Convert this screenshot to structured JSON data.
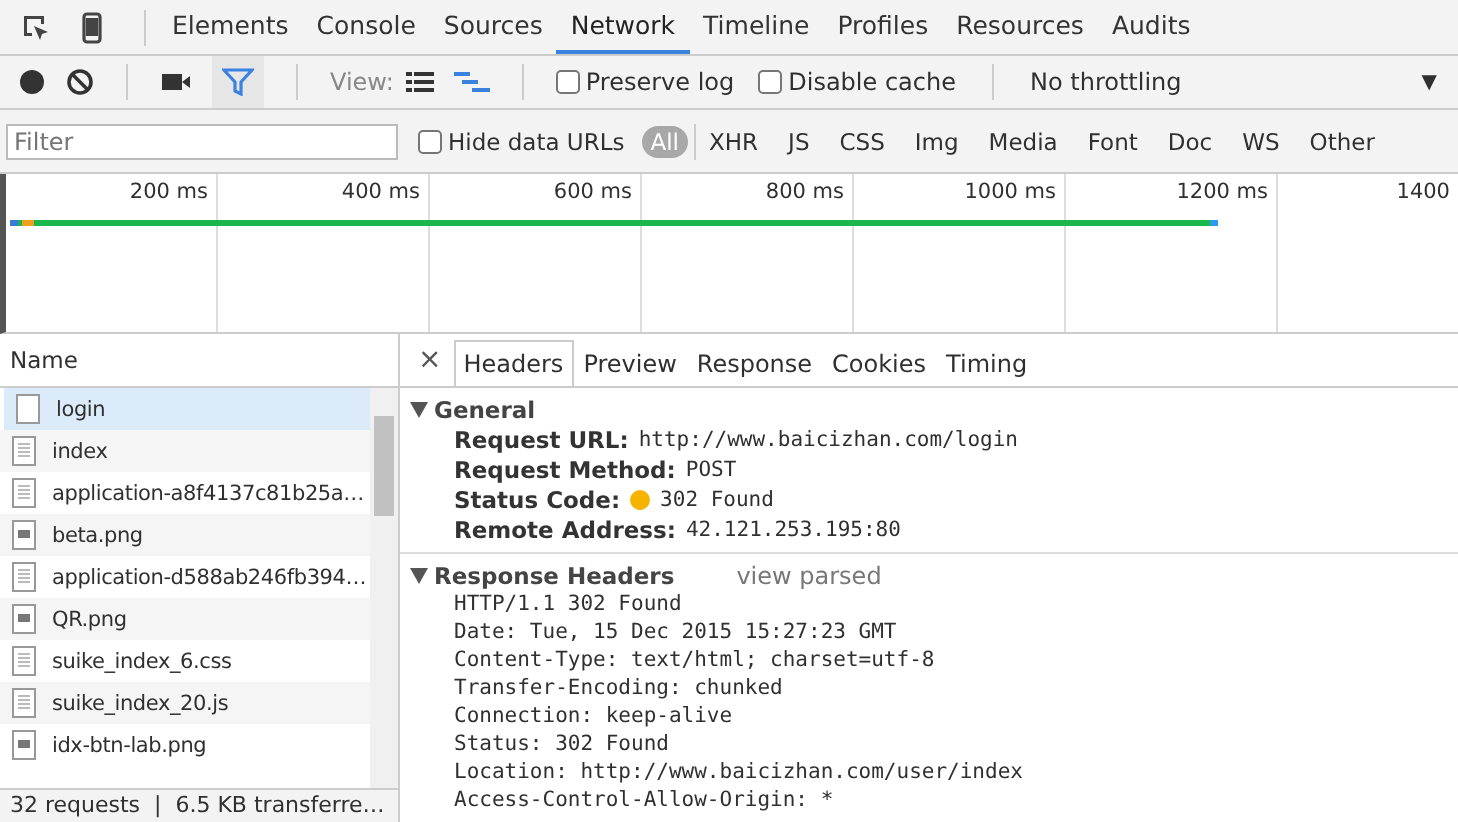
{
  "panel_tabs": [
    {
      "label": "Elements",
      "selected": false
    },
    {
      "label": "Console",
      "selected": false
    },
    {
      "label": "Sources",
      "selected": false
    },
    {
      "label": "Network",
      "selected": true
    },
    {
      "label": "Timeline",
      "selected": false
    },
    {
      "label": "Profiles",
      "selected": false
    },
    {
      "label": "Resources",
      "selected": false
    },
    {
      "label": "Audits",
      "selected": false
    }
  ],
  "toolbar": {
    "recording": false,
    "filter_on": true,
    "view_label": "View:",
    "preserve_log": {
      "label": "Preserve log",
      "checked": false
    },
    "disable_cache": {
      "label": "Disable cache",
      "checked": false
    },
    "throttling": "No throttling",
    "arrow": "▼"
  },
  "filter_bar": {
    "placeholder": "Filter",
    "hide_data_urls": {
      "label": "Hide data URLs",
      "checked": false
    },
    "types": [
      {
        "label": "All",
        "selected": true
      },
      {
        "label": "XHR",
        "selected": false
      },
      {
        "label": "JS",
        "selected": false
      },
      {
        "label": "CSS",
        "selected": false
      },
      {
        "label": "Img",
        "selected": false
      },
      {
        "label": "Media",
        "selected": false
      },
      {
        "label": "Font",
        "selected": false
      },
      {
        "label": "Doc",
        "selected": false
      },
      {
        "label": "WS",
        "selected": false
      },
      {
        "label": "Other",
        "selected": false
      }
    ]
  },
  "overview": {
    "ticks": [
      "200 ms",
      "400 ms",
      "600 ms",
      "800 ms",
      "1000 ms",
      "1200 ms",
      "1400"
    ]
  },
  "requests": {
    "column": "Name",
    "rows": [
      {
        "name": "login",
        "kind": "blank",
        "selected": true
      },
      {
        "name": "index",
        "kind": "text",
        "selected": false
      },
      {
        "name": "application-a8f4137c81b25a…",
        "kind": "text",
        "selected": false
      },
      {
        "name": "beta.png",
        "kind": "image",
        "selected": false
      },
      {
        "name": "application-d588ab246fb394…",
        "kind": "text",
        "selected": false
      },
      {
        "name": "QR.png",
        "kind": "image",
        "selected": false
      },
      {
        "name": "suike_index_6.css",
        "kind": "text",
        "selected": false
      },
      {
        "name": "suike_index_20.js",
        "kind": "text",
        "selected": false
      },
      {
        "name": "idx-btn-lab.png",
        "kind": "image",
        "selected": false
      }
    ],
    "status": "32 requests  |  6.5 KB transferre…"
  },
  "details": {
    "close": "×",
    "tabs": [
      {
        "label": "Headers",
        "selected": true
      },
      {
        "label": "Preview",
        "selected": false
      },
      {
        "label": "Response",
        "selected": false
      },
      {
        "label": "Cookies",
        "selected": false
      },
      {
        "label": "Timing",
        "selected": false
      }
    ],
    "general": {
      "title": "General",
      "expanded": true,
      "fields": [
        {
          "name": "Request URL:",
          "value": "http://www.baicizhan.com/login",
          "kind": "plain"
        },
        {
          "name": "Request Method:",
          "value": "POST",
          "kind": "plain"
        },
        {
          "name": "Status Code:",
          "value": "302 Found",
          "kind": "status"
        },
        {
          "name": "Remote Address:",
          "value": "42.121.253.195:80",
          "kind": "plain"
        }
      ]
    },
    "response_headers": {
      "title": "Response Headers",
      "expanded": true,
      "link": "view parsed",
      "lines": [
        "HTTP/1.1 302 Found",
        "Date: Tue, 15 Dec 2015 15:27:23 GMT",
        "Content-Type: text/html; charset=utf-8",
        "Transfer-Encoding: chunked",
        "Connection: keep-alive",
        "Status: 302 Found",
        "Location: http://www.baicizhan.com/user/index",
        "Access-Control-Allow-Origin: *"
      ]
    }
  }
}
